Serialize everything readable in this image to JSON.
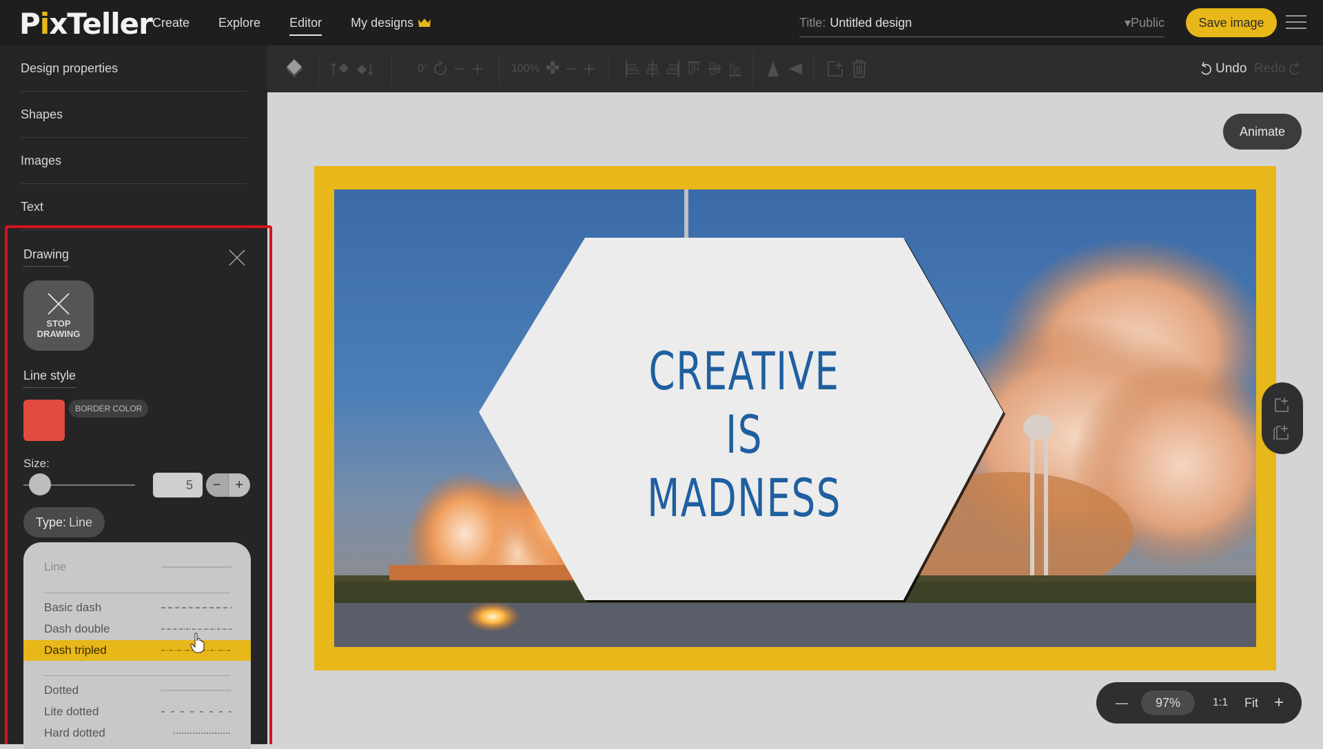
{
  "app": {
    "logo_prefix": "P",
    "logo_i": "i",
    "logo_suffix": "xTeller"
  },
  "nav": {
    "items": [
      {
        "label": "Create"
      },
      {
        "label": "Explore"
      },
      {
        "label": "Editor",
        "active": true
      },
      {
        "label": "My designs"
      }
    ]
  },
  "title_field": {
    "label": "Title:",
    "value": "Untitled design",
    "visibility": "▾Public"
  },
  "header": {
    "save_label": "Save image"
  },
  "sidebar": {
    "items": [
      {
        "label": "Design properties"
      },
      {
        "label": "Shapes"
      },
      {
        "label": "Images"
      },
      {
        "label": "Text"
      }
    ]
  },
  "drawing": {
    "title": "Drawing",
    "stop_line1": "STOP",
    "stop_line2": "DRAWING",
    "line_style_title": "Line style",
    "border_color_label": "BORDER COLOR",
    "border_color": "#e24b3f",
    "size_label": "Size:",
    "size_value": "5",
    "size_slider_fraction": 0.05,
    "minus": "−",
    "plus": "+",
    "type_label": "Type:",
    "type_value": "Line",
    "options": [
      {
        "name": "Line",
        "style": "solid",
        "state": "disabled"
      },
      {
        "name": "Basic dash",
        "style": "basic-dash",
        "state": "normal"
      },
      {
        "name": "Dash double",
        "style": "dash-double",
        "state": "normal"
      },
      {
        "name": "Dash tripled",
        "style": "dash-tripled",
        "state": "selected"
      },
      {
        "name": "Dotted",
        "style": "dotted",
        "state": "normal"
      },
      {
        "name": "Lite dotted",
        "style": "lite-dotted",
        "state": "normal"
      },
      {
        "name": "Hard dotted",
        "style": "hard-dotted",
        "state": "normal"
      }
    ]
  },
  "toolbar": {
    "rotation": "0°",
    "opacity": "100%",
    "undo_label": "Undo",
    "redo_label": "Redo"
  },
  "canvas": {
    "animate_label": "Animate",
    "frame_color": "#e8b719",
    "headline_line1": "CREATIVE",
    "headline_line2": "IS MADNESS",
    "headline_color": "#1f5fa0"
  },
  "zoom": {
    "minus": "—",
    "value": "97%",
    "one_to_one": "1:1",
    "fit": "Fit",
    "plus": "+"
  }
}
